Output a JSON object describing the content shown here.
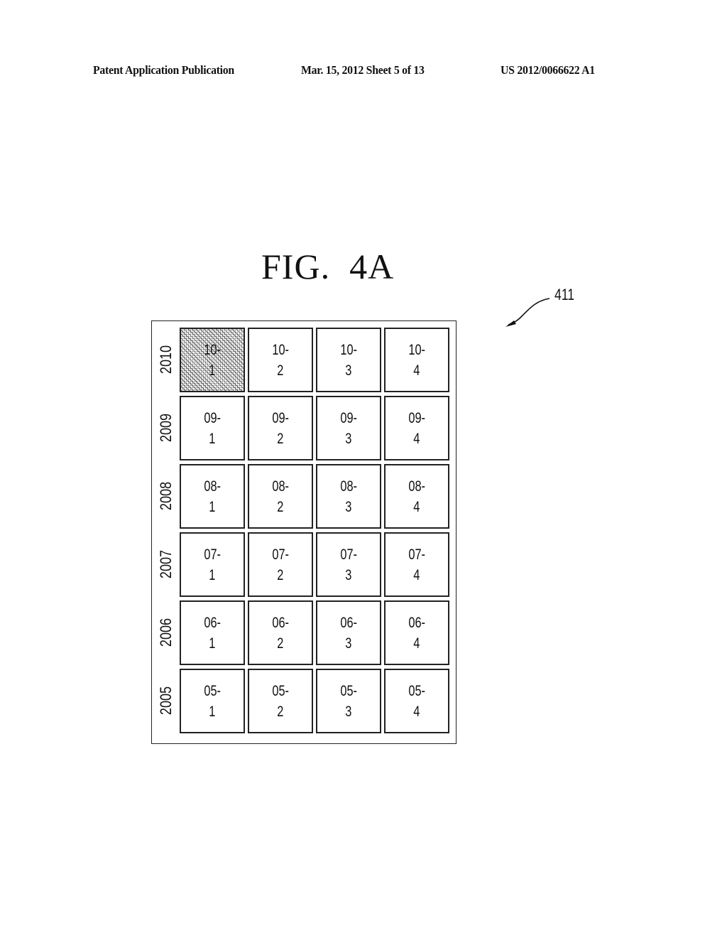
{
  "header": {
    "left": "Patent Application Publication",
    "middle": "Mar. 15, 2012  Sheet 5 of 13",
    "right": "US 2012/0066622 A1"
  },
  "figure": {
    "title": "FIG.  4A",
    "reference_numeral": "411"
  },
  "grid": {
    "selected_cell": "10-1",
    "rows": [
      {
        "year": "2010",
        "cells": [
          {
            "top": "10-",
            "bottom": "1",
            "selected": true
          },
          {
            "top": "10-",
            "bottom": "2"
          },
          {
            "top": "10-",
            "bottom": "3"
          },
          {
            "top": "10-",
            "bottom": "4"
          }
        ]
      },
      {
        "year": "2009",
        "cells": [
          {
            "top": "09-",
            "bottom": "1"
          },
          {
            "top": "09-",
            "bottom": "2"
          },
          {
            "top": "09-",
            "bottom": "3"
          },
          {
            "top": "09-",
            "bottom": "4"
          }
        ]
      },
      {
        "year": "2008",
        "cells": [
          {
            "top": "08-",
            "bottom": "1"
          },
          {
            "top": "08-",
            "bottom": "2"
          },
          {
            "top": "08-",
            "bottom": "3"
          },
          {
            "top": "08-",
            "bottom": "4"
          }
        ]
      },
      {
        "year": "2007",
        "cells": [
          {
            "top": "07-",
            "bottom": "1"
          },
          {
            "top": "07-",
            "bottom": "2"
          },
          {
            "top": "07-",
            "bottom": "3"
          },
          {
            "top": "07-",
            "bottom": "4"
          }
        ]
      },
      {
        "year": "2006",
        "cells": [
          {
            "top": "06-",
            "bottom": "1"
          },
          {
            "top": "06-",
            "bottom": "2"
          },
          {
            "top": "06-",
            "bottom": "3"
          },
          {
            "top": "06-",
            "bottom": "4"
          }
        ]
      },
      {
        "year": "2005",
        "cells": [
          {
            "top": "05-",
            "bottom": "1"
          },
          {
            "top": "05-",
            "bottom": "2"
          },
          {
            "top": "05-",
            "bottom": "3"
          },
          {
            "top": "05-",
            "bottom": "4"
          }
        ]
      }
    ]
  }
}
